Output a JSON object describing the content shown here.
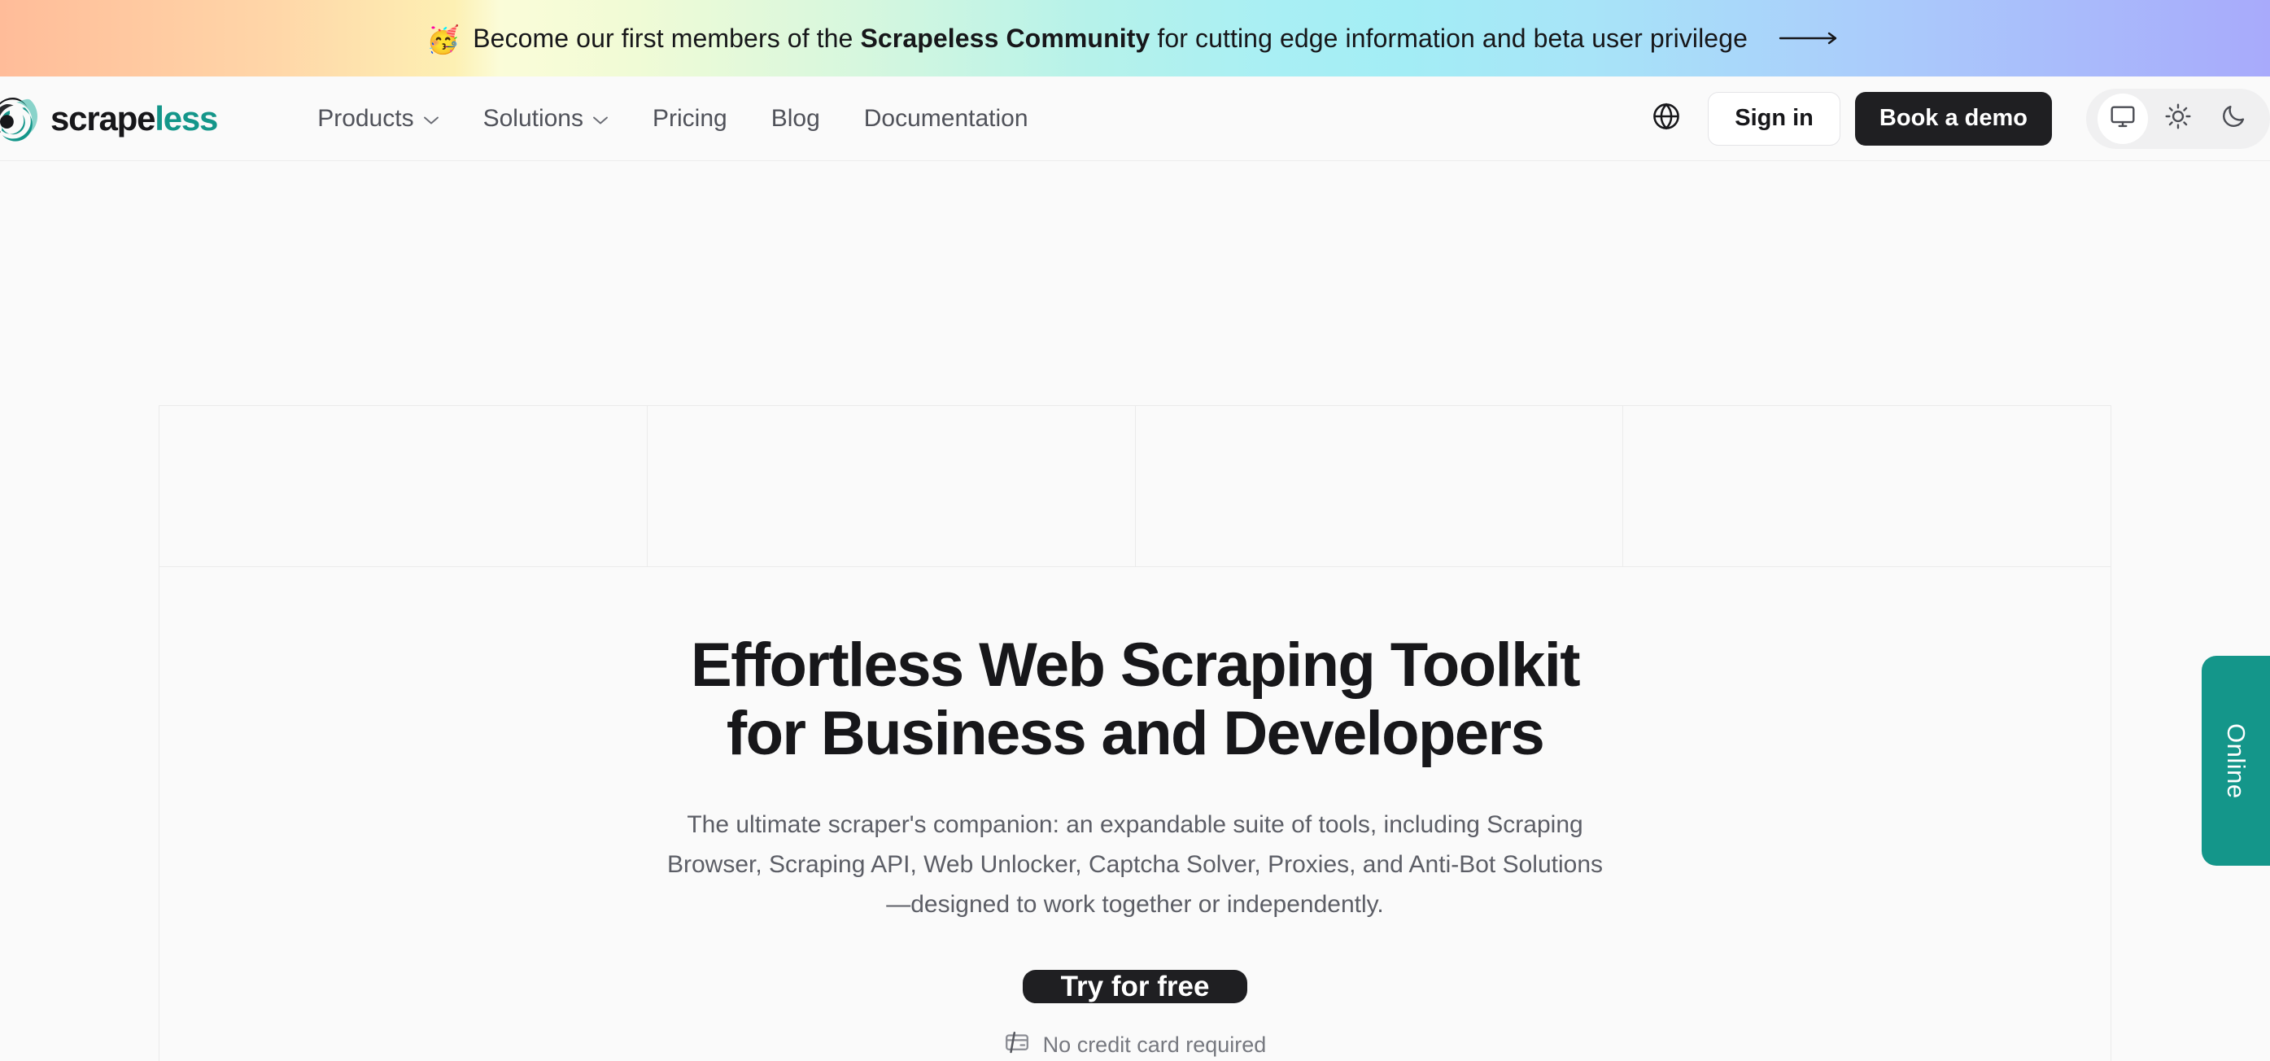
{
  "banner": {
    "emoji": "🥳",
    "text_before": "Become our first members of the ",
    "highlight": "Scrapeless Community",
    "text_after": " for cutting edge information and beta user privilege",
    "arrow_icon": "long-arrow-right-icon",
    "gradient": [
      "#ffbc99",
      "#fbfcd8",
      "#a3edf5",
      "#a8aafb"
    ]
  },
  "header": {
    "logo": {
      "mark_icon": "scrapeless-spiral-logo-icon",
      "word_dark": "scrape",
      "word_accent": "less",
      "accent_color": "#14968a"
    },
    "nav": [
      {
        "label": "Products",
        "has_caret": true
      },
      {
        "label": "Solutions",
        "has_caret": true
      },
      {
        "label": "Pricing",
        "has_caret": false
      },
      {
        "label": "Blog",
        "has_caret": false
      },
      {
        "label": "Documentation",
        "has_caret": false
      }
    ],
    "language_icon": "globe-icon",
    "sign_in_label": "Sign in",
    "book_demo_label": "Book a demo",
    "theme": {
      "options": [
        {
          "icon": "monitor-icon",
          "active": true
        },
        {
          "icon": "sun-icon",
          "active": false
        },
        {
          "icon": "moon-icon",
          "active": false
        }
      ]
    }
  },
  "hero": {
    "title_line_1": "Effortless Web Scraping Toolkit",
    "title_line_2": "for Business and Developers",
    "subtitle": "The ultimate scraper's companion: an expandable suite of tools, including Scraping Browser, Scraping API, Web Unlocker, Captcha Solver, Proxies, and Anti-Bot Solutions—designed to work together or independently.",
    "cta_label": "Try for free",
    "note_icon": "credit-card-off-icon",
    "note_label": "No credit card required",
    "grid_columns": 4
  },
  "chat_widget": {
    "label": "Online",
    "color": "#14968a"
  }
}
